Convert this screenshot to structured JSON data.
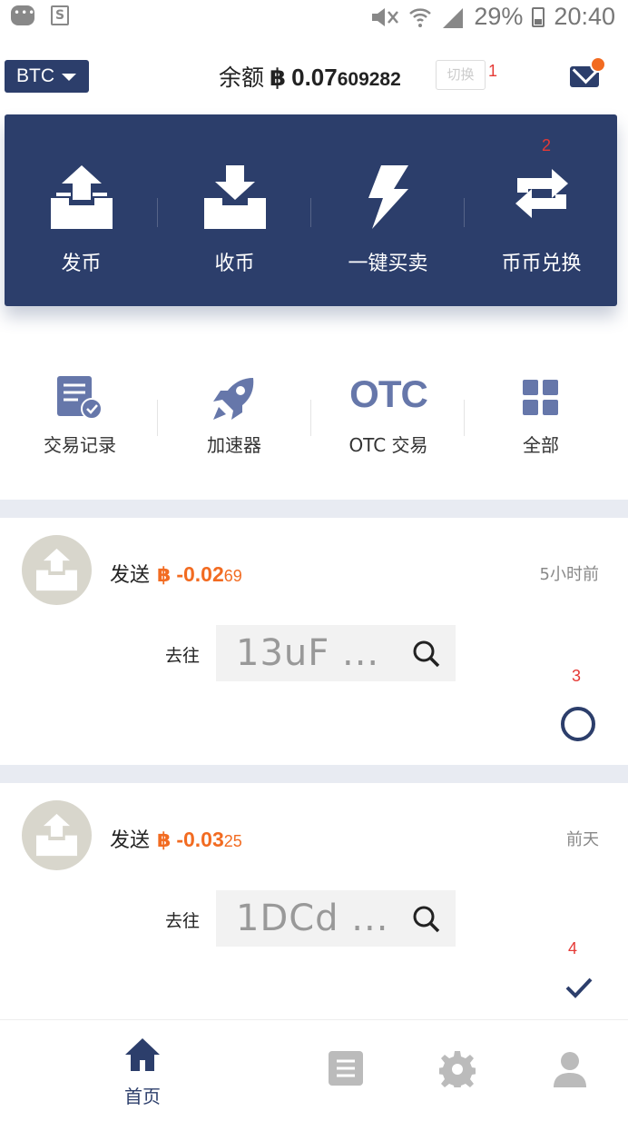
{
  "status_bar": {
    "battery": "29%",
    "time": "20:40"
  },
  "header": {
    "coin": "BTC",
    "balance_label": "余额",
    "currency_symbol": "฿",
    "balance_main": "0.07",
    "balance_minor": "609282",
    "switch_label": "切换"
  },
  "annotations": {
    "a1": "1",
    "a2": "2",
    "a3": "3",
    "a4": "4"
  },
  "actions": [
    {
      "label": "发币",
      "icon": "send-tray-icon"
    },
    {
      "label": "收币",
      "icon": "receive-tray-icon"
    },
    {
      "label": "一键买卖",
      "icon": "lightning-icon"
    },
    {
      "label": "币币兑换",
      "icon": "exchange-icon"
    }
  ],
  "quick_links": [
    {
      "label": "交易记录",
      "icon": "transaction-record-icon"
    },
    {
      "label": "加速器",
      "icon": "rocket-icon"
    },
    {
      "label": "OTC 交易",
      "icon_text": "OTC"
    },
    {
      "label": "全部",
      "icon": "grid-icon"
    }
  ],
  "transactions": [
    {
      "action": "发送",
      "symbol": "฿",
      "amount_main": "-0.02",
      "amount_minor": "69",
      "time": "5小时前",
      "to_label": "去往",
      "address": "13uF ...",
      "status": "pending"
    },
    {
      "action": "发送",
      "symbol": "฿",
      "amount_main": "-0.03",
      "amount_minor": "25",
      "time": "前天",
      "to_label": "去往",
      "address": "1DCd ...",
      "status": "confirmed"
    }
  ],
  "bottom_nav": {
    "home_label": "首页"
  },
  "colors": {
    "primary": "#2c3e6b",
    "accent": "#f26b21",
    "separator": "#e8ebf2"
  }
}
